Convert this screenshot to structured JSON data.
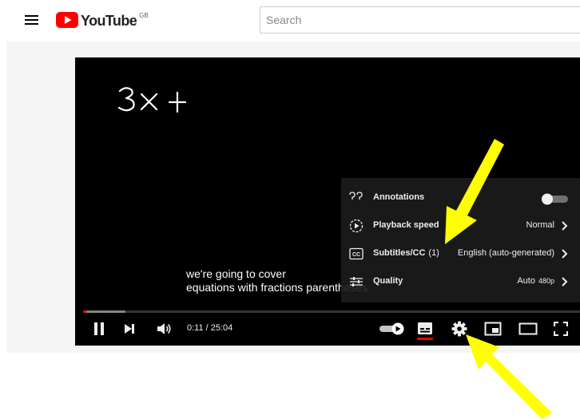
{
  "header": {
    "logo_text": "YouTube",
    "country_code": "GB",
    "search_placeholder": "Search"
  },
  "video": {
    "handwriting_text": "3x +",
    "caption_lines": [
      "we're going to cover",
      "equations with fractions parentheses"
    ],
    "progress_fraction": 0.007,
    "loaded_fraction": 0.085
  },
  "settings_menu": {
    "items": [
      {
        "label": "Annotations",
        "icon": "speech-bubble-icon",
        "value": "",
        "toggle_on": false
      },
      {
        "label": "Playback speed",
        "icon": "playback-speed-icon",
        "value": "Normal"
      },
      {
        "label": "Subtitles/CC",
        "count": "(1)",
        "icon": "subtitles-icon",
        "value": "English (auto-generated)"
      },
      {
        "label": "Quality",
        "icon": "quality-sliders-icon",
        "value": "Auto",
        "value_suffix": "480p"
      }
    ]
  },
  "controls": {
    "current_time": "0:11",
    "duration": "25:04",
    "time_display": "0:11 / 25:04",
    "autoplay_on": true,
    "icons": [
      "pause-icon",
      "next-icon",
      "volume-icon",
      "autoplay-toggle",
      "subtitles-icon",
      "settings-gear-icon",
      "miniplayer-icon",
      "theater-mode-icon",
      "fullscreen-icon"
    ]
  },
  "colors": {
    "youtube_red": "#ff0000",
    "arrow_yellow": "#ffff00",
    "player_bg": "#000000",
    "menu_bg": "#1c1c1c"
  }
}
